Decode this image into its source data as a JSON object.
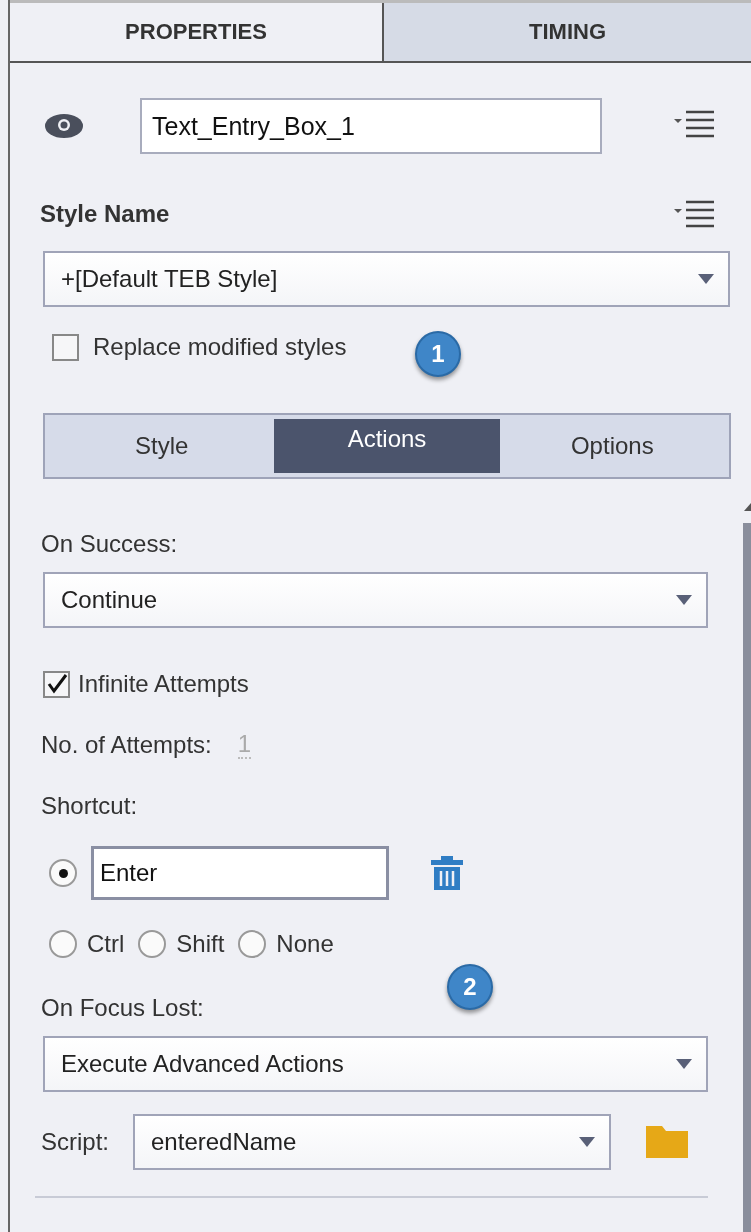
{
  "panel_tabs": [
    {
      "label": "PROPERTIES",
      "selected": true
    },
    {
      "label": "TIMING",
      "selected": false
    }
  ],
  "object_name": "Text_Entry_Box_1",
  "style": {
    "label": "Style Name",
    "value": "+[Default TEB Style]",
    "replace": {
      "label": "Replace modified styles",
      "checked": false
    },
    "callout": "1"
  },
  "sub_tabs": [
    {
      "label": "Style",
      "selected": false
    },
    {
      "label": "Actions",
      "selected": true
    },
    {
      "label": "Options",
      "selected": false
    }
  ],
  "on_success": {
    "label": "On Success:",
    "value": "Continue"
  },
  "infinite_attempts": {
    "label": "Infinite Attempts",
    "checked": true
  },
  "attempts": {
    "label": "No. of Attempts:",
    "value": "1",
    "disabled": true
  },
  "shortcut": {
    "label": "Shortcut:",
    "key": {
      "value": "Enter",
      "selected": true
    },
    "modifiers": [
      {
        "label": "Ctrl",
        "selected": false
      },
      {
        "label": "Shift",
        "selected": false
      },
      {
        "label": "None",
        "selected": false
      }
    ]
  },
  "on_focus_lost": {
    "label": "On Focus Lost:",
    "value": "Execute Advanced Actions",
    "callout": "2"
  },
  "script": {
    "label": "Script:",
    "value": "enteredName"
  }
}
